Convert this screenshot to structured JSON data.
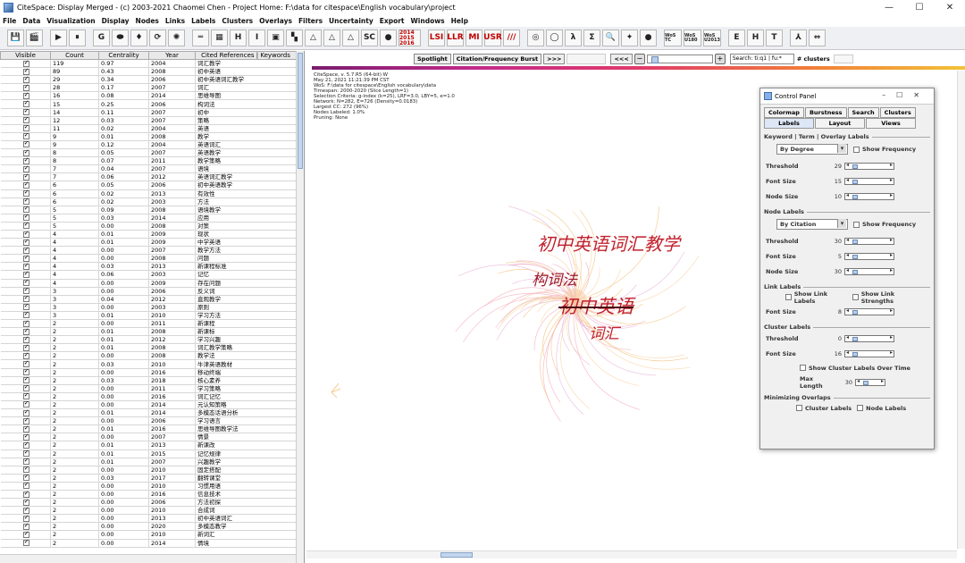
{
  "window": {
    "title": "CiteSpace: Display Merged - (c) 2003-2021 Chaomei Chen - Project Home: F:\\data for citespace\\English vocabulary\\project",
    "minimize": "—",
    "maximize": "☐",
    "close": "✕"
  },
  "menu": [
    "File",
    "Data",
    "Visualization",
    "Display",
    "Nodes",
    "Links",
    "Labels",
    "Clusters",
    "Overlays",
    "Filters",
    "Uncertainty",
    "Export",
    "Windows",
    "Help"
  ],
  "toolbar": {
    "buttons": [
      "💾",
      "🎬",
      "▶",
      "⏸",
      "G",
      "⬬",
      "♦",
      "⟳",
      "✺",
      "═",
      "▦",
      "H",
      "I",
      "▣",
      "▚",
      "△",
      "△",
      "△",
      "SC",
      "●"
    ],
    "button_2014": "2014 2015 2016",
    "red_buttons": [
      "LSI",
      "LLR",
      "MI",
      "USR",
      "///"
    ],
    "buttons2": [
      "◎",
      "◯",
      "λ",
      "Σ",
      "🔍",
      "✦",
      "●"
    ],
    "wos_buttons": [
      "WoS TC",
      "WoS U180",
      "WoS U2013"
    ],
    "letter_buttons": [
      "E",
      "H",
      "T",
      "⅄",
      "⇔"
    ]
  },
  "table": {
    "headers": [
      "Visible",
      "Count",
      "Centrality",
      "Year",
      "Cited References | Keywords"
    ],
    "rows": [
      [
        "119",
        "0.97",
        "2004",
        "词汇教学"
      ],
      [
        "89",
        "0.43",
        "2008",
        "初中英语"
      ],
      [
        "29",
        "0.34",
        "2006",
        "初中英语词汇教学"
      ],
      [
        "28",
        "0.17",
        "2007",
        "词汇"
      ],
      [
        "16",
        "0.08",
        "2014",
        "思维导图"
      ],
      [
        "15",
        "0.25",
        "2006",
        "构词法"
      ],
      [
        "14",
        "0.11",
        "2007",
        "初中"
      ],
      [
        "12",
        "0.03",
        "2007",
        "策略"
      ],
      [
        "11",
        "0.02",
        "2004",
        "英语"
      ],
      [
        "9",
        "0.01",
        "2008",
        "教学"
      ],
      [
        "9",
        "0.12",
        "2004",
        "英语词汇"
      ],
      [
        "8",
        "0.05",
        "2007",
        "英语教学"
      ],
      [
        "8",
        "0.07",
        "2011",
        "教学策略"
      ],
      [
        "7",
        "0.04",
        "2007",
        "语境"
      ],
      [
        "7",
        "0.06",
        "2012",
        "英语词汇教学"
      ],
      [
        "6",
        "0.05",
        "2006",
        "初中英语教学"
      ],
      [
        "6",
        "0.02",
        "2013",
        "有效性"
      ],
      [
        "6",
        "0.02",
        "2003",
        "方法"
      ],
      [
        "5",
        "0.09",
        "2008",
        "语境教学"
      ],
      [
        "5",
        "0.03",
        "2014",
        "应用"
      ],
      [
        "5",
        "0.00",
        "2008",
        "对策"
      ],
      [
        "4",
        "0.01",
        "2009",
        "现状"
      ],
      [
        "4",
        "0.01",
        "2009",
        "中学英语"
      ],
      [
        "4",
        "0.00",
        "2007",
        "教学方法"
      ],
      [
        "4",
        "0.00",
        "2008",
        "问题"
      ],
      [
        "4",
        "0.03",
        "2013",
        "新课程标准"
      ],
      [
        "4",
        "0.06",
        "2003",
        "记忆"
      ],
      [
        "4",
        "0.00",
        "2009",
        "存在问题"
      ],
      [
        "3",
        "0.00",
        "2006",
        "反义词"
      ],
      [
        "3",
        "0.04",
        "2012",
        "直观教学"
      ],
      [
        "3",
        "0.00",
        "2003",
        "原则"
      ],
      [
        "3",
        "0.01",
        "2010",
        "学习方法"
      ],
      [
        "2",
        "0.00",
        "2011",
        "新课程"
      ],
      [
        "2",
        "0.01",
        "2008",
        "新课标"
      ],
      [
        "2",
        "0.01",
        "2012",
        "学习兴趣"
      ],
      [
        "2",
        "0.01",
        "2008",
        "词汇教学策略"
      ],
      [
        "2",
        "0.00",
        "2008",
        "教学法"
      ],
      [
        "2",
        "0.03",
        "2010",
        "牛津英语教材"
      ],
      [
        "2",
        "0.00",
        "2016",
        "移动终端"
      ],
      [
        "2",
        "0.03",
        "2018",
        "核心素养"
      ],
      [
        "2",
        "0.00",
        "2011",
        "学习策略"
      ],
      [
        "2",
        "0.00",
        "2016",
        "词汇记忆"
      ],
      [
        "2",
        "0.00",
        "2014",
        "元认知策略"
      ],
      [
        "2",
        "0.01",
        "2014",
        "多模态话语分析"
      ],
      [
        "2",
        "0.00",
        "2006",
        "学习语言"
      ],
      [
        "2",
        "0.01",
        "2016",
        "思维导图教学法"
      ],
      [
        "2",
        "0.00",
        "2007",
        "情景"
      ],
      [
        "2",
        "0.01",
        "2013",
        "新课改"
      ],
      [
        "2",
        "0.01",
        "2015",
        "记忆规律"
      ],
      [
        "2",
        "0.01",
        "2007",
        "兴趣教学"
      ],
      [
        "2",
        "0.00",
        "2010",
        "固定搭配"
      ],
      [
        "2",
        "0.03",
        "2017",
        "翻转课堂"
      ],
      [
        "2",
        "0.00",
        "2010",
        "习惯用语"
      ],
      [
        "2",
        "0.00",
        "2016",
        "信息技术"
      ],
      [
        "2",
        "0.00",
        "2006",
        "方法初探"
      ],
      [
        "2",
        "0.00",
        "2010",
        "合成词"
      ],
      [
        "2",
        "0.00",
        "2013",
        "初中英语词汇"
      ],
      [
        "2",
        "0.00",
        "2020",
        "多模态教学"
      ],
      [
        "2",
        "0.00",
        "2010",
        "新词汇"
      ],
      [
        "2",
        "0.00",
        "2014",
        "情境"
      ]
    ]
  },
  "view_toolbar": {
    "spotlight": "Spotlight",
    "burst": "Citation/Frequency Burst",
    "next": ">>>",
    "prev": "<<<",
    "search": "Search: ti:q1 | fu:*",
    "clusters_label": "# clusters"
  },
  "info_text": "CiteSpace, v. 5.7.R5 (64-bit) W\nMay 21, 2021 11:21:39 PM CST\nWoS: F:\\data for citespace\\English vocabulary\\data\nTimespan: 2000-2020 (Slice Length=1)\nSelection Criteria: g-index (k=25), LRF=3.0, LBY=5, e=1.0\nNetwork: N=282, E=726 (Density=0.0183)\nLargest CC: 272 (96%)\nNodes Labeled: 1.0%\nPruning: None",
  "network_labels": [
    "初中英语词汇教学",
    "构词法",
    "初中英语",
    "词汇"
  ],
  "control_panel": {
    "title": "Control Panel",
    "tabs_row1": [
      "Colormap",
      "Burstness",
      "Search",
      "Clusters"
    ],
    "tabs_row2": [
      "Labels",
      "Layout",
      "Views"
    ],
    "kw_section": "Keyword | Term | Overlay Labels",
    "kw_mode": "By Degree",
    "show_frequency": "Show Frequency",
    "threshold_label": "Threshold",
    "font_size_label": "Font Size",
    "node_size_label": "Node Size",
    "kw_threshold": "29",
    "kw_font_size": "15",
    "kw_node_size": "10",
    "node_section": "Node Labels",
    "node_mode": "By Citation",
    "node_threshold": "30",
    "node_font_size": "5",
    "node_node_size": "30",
    "link_section": "Link Labels",
    "show_link_labels": "Show Link Labels",
    "show_link_strengths": "Show Link Strengths",
    "link_font_size": "8",
    "cluster_section": "Cluster Labels",
    "cluster_threshold": "0",
    "cluster_font_size": "16",
    "show_cluster_labels_over_time": "Show Cluster Labels Over Time",
    "max_length_label": "Max Length",
    "max_length": "30",
    "overlap_section": "Minimizing Overlaps",
    "cluster_labels": "Cluster Labels",
    "node_labels": "Node Labels"
  },
  "colors": {
    "label_red": "#c0202c",
    "node_pink": "#f4a8b8",
    "node_orange": "#f3c07a"
  }
}
